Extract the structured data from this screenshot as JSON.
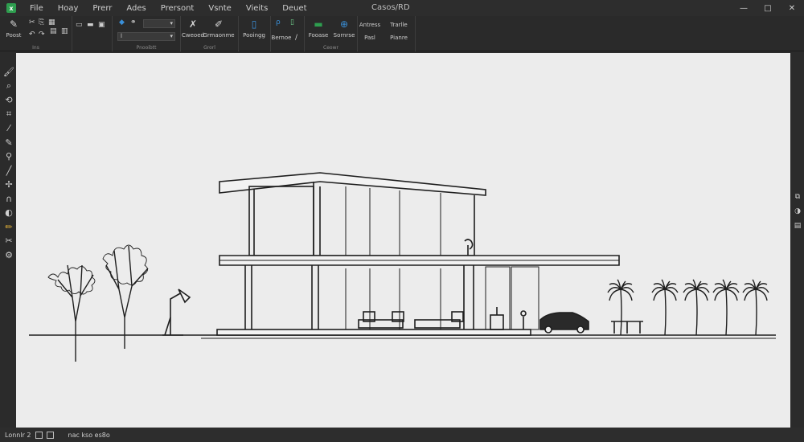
{
  "window": {
    "title": "Casos/RD",
    "controls": {
      "minimize": "—",
      "maximize": "□",
      "close": "✕"
    }
  },
  "menu": [
    "File",
    "Hoay",
    "Prerr",
    "Ades",
    "Prersont",
    "Vsnte",
    "Vieits",
    "Deuet"
  ],
  "ribbon": {
    "groups": [
      {
        "label": "Ins"
      },
      {
        "label": "Pnooibtt"
      },
      {
        "label": "Grorl"
      },
      {
        "label": "Ceowr"
      }
    ],
    "buttons": {
      "paste": "Poost",
      "curved": "Cweoed",
      "sharpener": "Grmaonme",
      "process": "Pooingg",
      "renal": "Bernoe",
      "trace": "Fooase",
      "stamps": "Sornrse",
      "addons": "Antress",
      "pull": "Pasl",
      "trail": "Trarlle",
      "plane": "Pianre"
    },
    "combo_value": "l"
  },
  "icons": {
    "app": "spreadsheet-app-icon",
    "accent": "#e0b13a",
    "ribbon_blue": "#3a8fd8",
    "ribbon_green": "#2e9e4f"
  },
  "status": {
    "page": "Lonnlr 2",
    "coords": "nac kso es8o"
  }
}
